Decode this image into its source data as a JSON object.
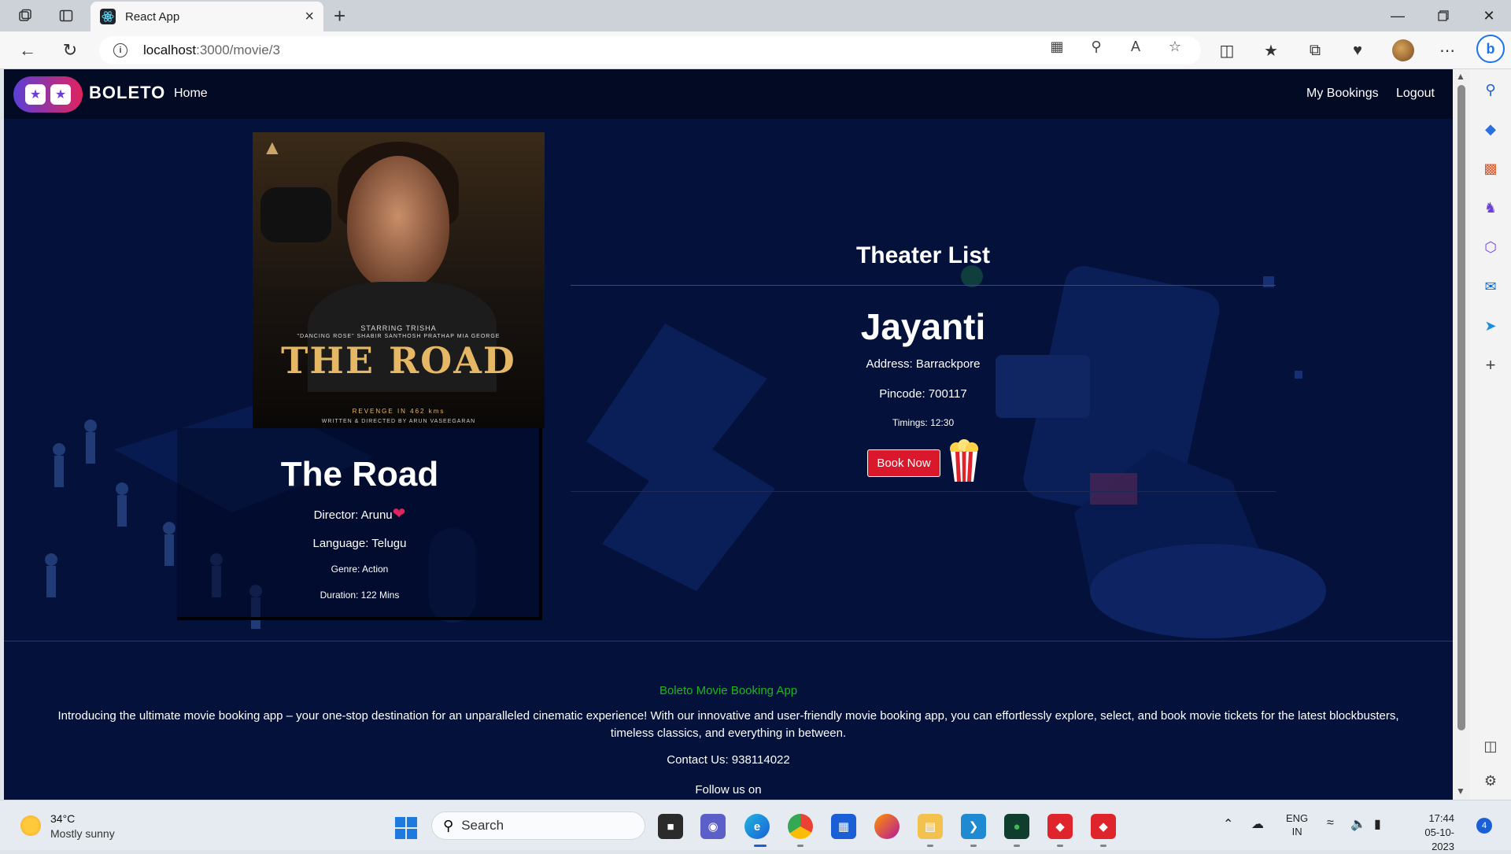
{
  "browser": {
    "tab_title": "React App",
    "url_host": "localhost",
    "url_path": ":3000/movie/3",
    "new_tab_symbol": "+",
    "close_symbol": "×"
  },
  "site": {
    "brand": "BOLETO",
    "nav": {
      "home": "Home",
      "my_bookings": "My Bookings",
      "logout": "Logout"
    }
  },
  "movie": {
    "poster_starring": "STARRING  TRISHA",
    "poster_cast": "\"DANCING ROSE\"  SHABIR  SANTHOSH PRATHAP  MIA GEORGE",
    "poster_title": "THE ROAD",
    "poster_tagline": "REVENGE IN 462 kms",
    "poster_credit": "WRITTEN & DIRECTED BY  ARUN VASEEGARAN",
    "title": "The Road",
    "director": "Director: Arunu",
    "language": "Language: Telugu",
    "genre": "Genre: Action",
    "duration": "Duration: 122 Mins"
  },
  "theater": {
    "heading": "Theater List",
    "name": "Jayanti",
    "address": "Address: Barrackpore",
    "pincode": "Pincode: 700117",
    "timings": "Timings: 12:30",
    "book_button": "Book Now"
  },
  "footer": {
    "title": "Boleto Movie Booking App",
    "description": "Introducing the ultimate movie booking app – your one-stop destination for an unparalleled cinematic experience! With our innovative and user-friendly movie booking app, you can effortlessly explore, select, and book movie tickets for the latest blockbusters, timeless classics, and everything in between.",
    "contact": "Contact Us: 938114022",
    "follow": "Follow us on"
  },
  "taskbar": {
    "weather_temp": "34°C",
    "weather_desc": "Mostly sunny",
    "search_label": "Search",
    "lang_1": "ENG",
    "lang_2": "IN",
    "time": "17:44",
    "date": "05-10-2023",
    "notifications": "4"
  },
  "colors": {
    "page_bg": "#03113b",
    "header_bg": "#020a24",
    "accent_red": "#d9182b",
    "footer_green": "#1eb61e"
  }
}
